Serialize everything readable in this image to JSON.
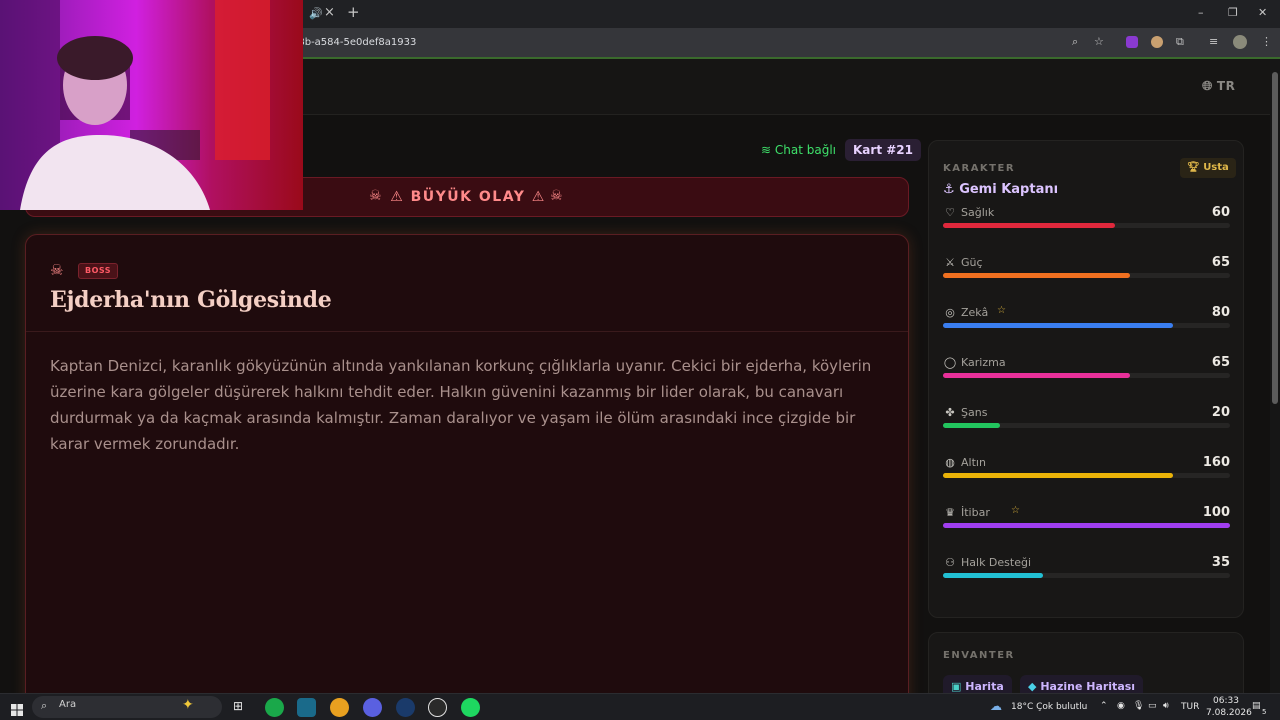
{
  "browser": {
    "url": "58b-a584-5e0def8a1933",
    "new_tab": "+",
    "tab_close": "×"
  },
  "header": {
    "language": "TR"
  },
  "status": {
    "chat": "Chat bağlı",
    "card": "Kart #21"
  },
  "event": {
    "banner": "⚠ BÜYÜK OLAY ⚠"
  },
  "card": {
    "badge": "BOSS",
    "title": "Ejderha'nın Gölgesinde",
    "body": "Kaptan Denizci, karanlık gökyüzünün altında yankılanan korkunç çığlıklarla uyanır. Cekici bir ejderha, köylerin üzerine kara gölgeler düşürerek halkını tehdit eder. Halkın güvenini kazanmış bir lider olarak, bu canavarı durdurmak ya da kaçmak arasında kalmıştır. Zaman daralıyor ve yaşam ile ölüm arasındaki ince çizgide bir karar vermek zorundadır."
  },
  "character": {
    "heading": "KARAKTER",
    "rank": "Usta",
    "name": "Gemi Kaptanı",
    "stats": [
      {
        "label": "Sağlık",
        "value": "60",
        "fill": 0.6,
        "color": "#e0283c",
        "icon": "heart-icon",
        "star": false
      },
      {
        "label": "Güç",
        "value": "65",
        "fill": 0.65,
        "color": "#f07020",
        "icon": "sword-icon",
        "star": false
      },
      {
        "label": "Zekâ",
        "value": "80",
        "fill": 0.8,
        "color": "#3a7ef0",
        "icon": "brain-icon",
        "star": true
      },
      {
        "label": "Karizma",
        "value": "65",
        "fill": 0.65,
        "color": "#e8309a",
        "icon": "chat-bubble-icon",
        "star": false
      },
      {
        "label": "Şans",
        "value": "20",
        "fill": 0.2,
        "color": "#22c55e",
        "icon": "clover-icon",
        "star": false
      },
      {
        "label": "Altın",
        "value": "160",
        "fill": 0.8,
        "color": "#eab308",
        "icon": "coins-icon",
        "star": false
      },
      {
        "label": "İtibar",
        "value": "100",
        "fill": 1.0,
        "color": "#a03ef0",
        "icon": "crown-icon",
        "star": true
      },
      {
        "label": "Halk Desteği",
        "value": "35",
        "fill": 0.35,
        "color": "#22c0d4",
        "icon": "people-icon",
        "star": false
      }
    ]
  },
  "inventory": {
    "heading": "ENVANTER",
    "items": [
      "Harita",
      "Hazine Haritası"
    ]
  },
  "taskbar": {
    "search": "Ara",
    "weather": "18°C  Çok bulutlu",
    "lang": "TUR",
    "time": "06:33",
    "date": "7.08.2026",
    "notifications": "5"
  }
}
